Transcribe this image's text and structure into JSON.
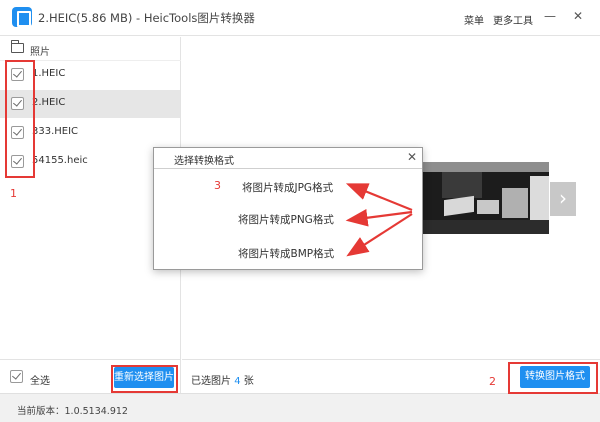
{
  "titlebar": {
    "title": "2.HEIC(5.86 MB) - HeicTools图片转换器",
    "menu_label": "菜单",
    "tools_label": "更多工具",
    "minimize": "—",
    "close": "✕"
  },
  "left_panel": {
    "folder_label": "照片",
    "files": [
      {
        "name": "1.HEIC"
      },
      {
        "name": "2.HEIC"
      },
      {
        "name": "333.HEIC"
      },
      {
        "name": "54155.heic"
      }
    ],
    "select_all_label": "全选",
    "reselect_button": "重新选择图片"
  },
  "right_panel": {
    "selected_prefix": "已选图片",
    "selected_count": "4",
    "selected_suffix": "张",
    "convert_button": "转换图片格式",
    "next_arrow": "›"
  },
  "statusbar": {
    "version": "当前版本：1.0.5134.912"
  },
  "dialog": {
    "title": "选择转换格式",
    "close": "✕",
    "options": [
      "将图片转成JPG格式",
      "将图片转成PNG格式",
      "将图片转成BMP格式"
    ]
  },
  "annotations": {
    "n1": "1",
    "n2": "2",
    "n3": "3",
    "color": "#e53935"
  },
  "colors": {
    "accent": "#1f8ff0"
  }
}
